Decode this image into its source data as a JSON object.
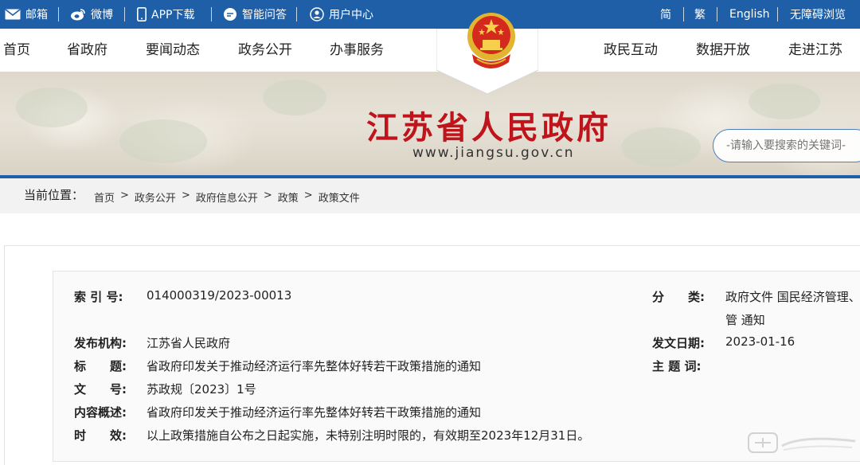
{
  "topbar": {
    "mail": "邮箱",
    "weibo": "微博",
    "app": "APP下载",
    "qa": "智能问答",
    "user": "用户中心",
    "simplified": "简",
    "traditional": "繁",
    "english": "English",
    "accessible": "无障碍浏览"
  },
  "nav": {
    "home": "首页",
    "province": "省政府",
    "news": "要闻动态",
    "affairs": "政务公开",
    "services": "办事服务",
    "interaction": "政民互动",
    "data": "数据开放",
    "explore": "走进江苏"
  },
  "banner": {
    "title": "江苏省人民政府",
    "url": "www.jiangsu.gov.cn",
    "search_placeholder": "-请输入要搜索的关键词-"
  },
  "breadcrumb": {
    "label": "当前位置：",
    "items": [
      "首页",
      "政务公开",
      "政府信息公开",
      "政策",
      "政策文件"
    ],
    "separator": ">"
  },
  "doc": {
    "index_label": "索 引 号:",
    "index_value": "014000319/2023-00013",
    "category_label": "分　　类:",
    "category_value_line1": "政府文件 国民经济管理、",
    "category_value_line2": "管 通知",
    "issuer_label": "发布机构:",
    "issuer_value": "江苏省人民政府",
    "date_label": "发文日期:",
    "date_value": "2023-01-16",
    "title_label": "标　　题:",
    "title_value": "省政府印发关于推动经济运行率先整体好转若干政策措施的通知",
    "keywords_label": "主 题 词:",
    "keywords_value": "",
    "docno_label": "文　　号:",
    "docno_value": "苏政规〔2023〕1号",
    "summary_label": "内容概述:",
    "summary_value": "省政府印发关于推动经济运行率先整体好转若干政策措施的通知",
    "validity_label": "时　　效:",
    "validity_value": "以上政策措施自公布之日起实施，未特别注明时限的，有效期至2023年12月31日。"
  },
  "colors": {
    "topbar": "#1f5fa8",
    "title_red": "#c0141c",
    "emblem_gold": "#e2b531"
  }
}
